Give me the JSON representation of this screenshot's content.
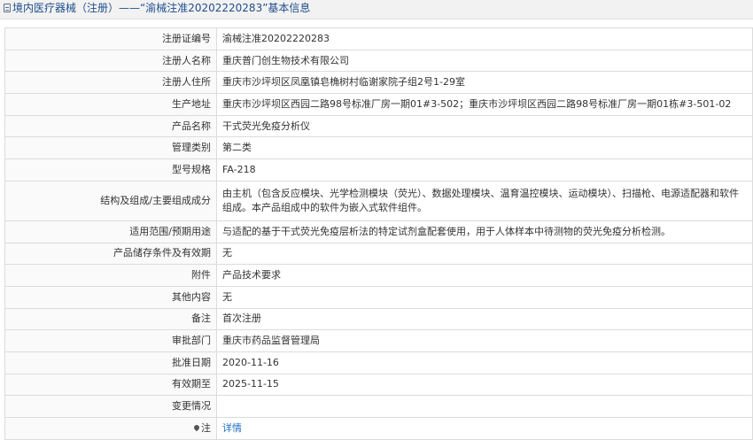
{
  "header": {
    "title": "境内医疗器械（注册）——“渝械注准20202220283”基本信息"
  },
  "rows": [
    {
      "label": "注册证编号",
      "value": "渝械注准20202220283"
    },
    {
      "label": "注册人名称",
      "value": "重庆普门创生物技术有限公司"
    },
    {
      "label": "注册人住所",
      "value": "重庆市沙坪坝区凤凰镇皂桷树村临谢家院子组2号1-29室"
    },
    {
      "label": "生产地址",
      "value": "重庆市沙坪坝区西园二路98号标准厂房一期01#3-502；重庆市沙坪坝区西园二路98号标准厂房一期01栋#3-501-02"
    },
    {
      "label": "产品名称",
      "value": "干式荧光免疫分析仪"
    },
    {
      "label": "管理类别",
      "value": "第二类"
    },
    {
      "label": "型号规格",
      "value": "FA-218"
    },
    {
      "label": "结构及组成/主要组成成分",
      "value": "由主机（包含反应模块、光学检测模块（荧光）、数据处理模块、温育温控模块、运动模块）、扫描枪、电源适配器和软件组成。本产品组成中的软件为嵌入式软件组件。"
    },
    {
      "label": "适用范围/预期用途",
      "value": "与适配的基于干式荧光免疫层析法的特定试剂盒配套使用，用于人体样本中待测物的荧光免疫分析检测。"
    },
    {
      "label": "产品储存条件及有效期",
      "value": "无"
    },
    {
      "label": "附件",
      "value": "产品技术要求"
    },
    {
      "label": "其他内容",
      "value": "无"
    },
    {
      "label": "备注",
      "value": "首次注册"
    },
    {
      "label": "审批部门",
      "value": "重庆市药品监督管理局"
    },
    {
      "label": "批准日期",
      "value": "2020-11-16"
    },
    {
      "label": "有效期至",
      "value": "2025-11-15"
    },
    {
      "label": "变更情况",
      "value": ""
    }
  ],
  "note": {
    "label": "注",
    "link": "详情"
  }
}
